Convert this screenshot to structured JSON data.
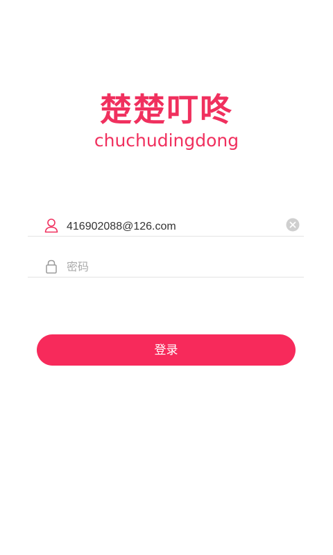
{
  "brand": {
    "name_cn": "楚楚叮咚",
    "name_en": "chuchudingdong",
    "color": "#f0305e"
  },
  "login_form": {
    "username": {
      "icon": "user-icon",
      "value": "416902088@126.com",
      "clear_icon": "clear-icon"
    },
    "password": {
      "icon": "lock-icon",
      "placeholder": "密码"
    },
    "submit_label": "登录",
    "button_color": "#f72a5b"
  }
}
